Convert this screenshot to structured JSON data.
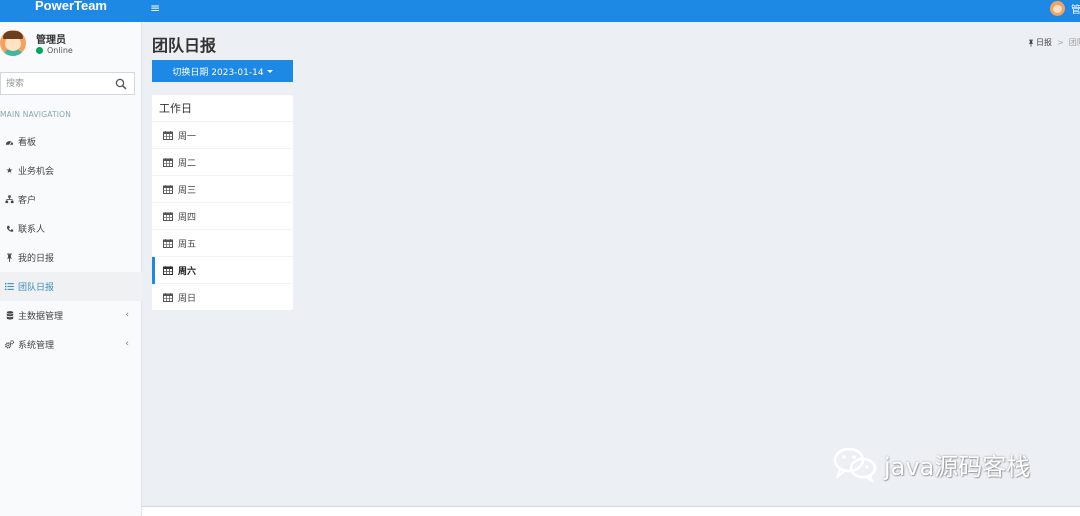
{
  "app": {
    "logo": "PowerTeam",
    "menu_icon": "hamburger-icon"
  },
  "topbar": {
    "user_initial": "管"
  },
  "user": {
    "name": "管理员",
    "status": "Online",
    "status_color": "#00a65a"
  },
  "search": {
    "placeholder": "搜索"
  },
  "nav": {
    "header": "MAIN NAVIGATION",
    "items": [
      {
        "label": "看板",
        "icon": "dashboard-icon"
      },
      {
        "label": "业务机会",
        "icon": "star-icon"
      },
      {
        "label": "客户",
        "icon": "sitemap-icon"
      },
      {
        "label": "联系人",
        "icon": "phone-icon"
      },
      {
        "label": "我的日报",
        "icon": "pin-icon"
      },
      {
        "label": "团队日报",
        "icon": "list-icon",
        "active": true
      },
      {
        "label": "主数据管理",
        "icon": "database-icon",
        "has_children": true
      },
      {
        "label": "系统管理",
        "icon": "gears-icon",
        "has_children": true
      }
    ]
  },
  "page": {
    "title": "团队日报",
    "breadcrumb": [
      "日报",
      "团队"
    ]
  },
  "date_switch": {
    "label": "切换日期 2023-01-14"
  },
  "workdays": {
    "title": "工作日",
    "days": [
      "周一",
      "周二",
      "周三",
      "周四",
      "周五",
      "周六",
      "周日"
    ],
    "selected": "周六"
  },
  "watermark": {
    "text": "java源码客栈"
  },
  "colors": {
    "primary": "#1e88e5",
    "sidebar_bg": "#f9fafc",
    "content_bg": "#ecf0f5",
    "link_active": "#3c8dbc"
  }
}
